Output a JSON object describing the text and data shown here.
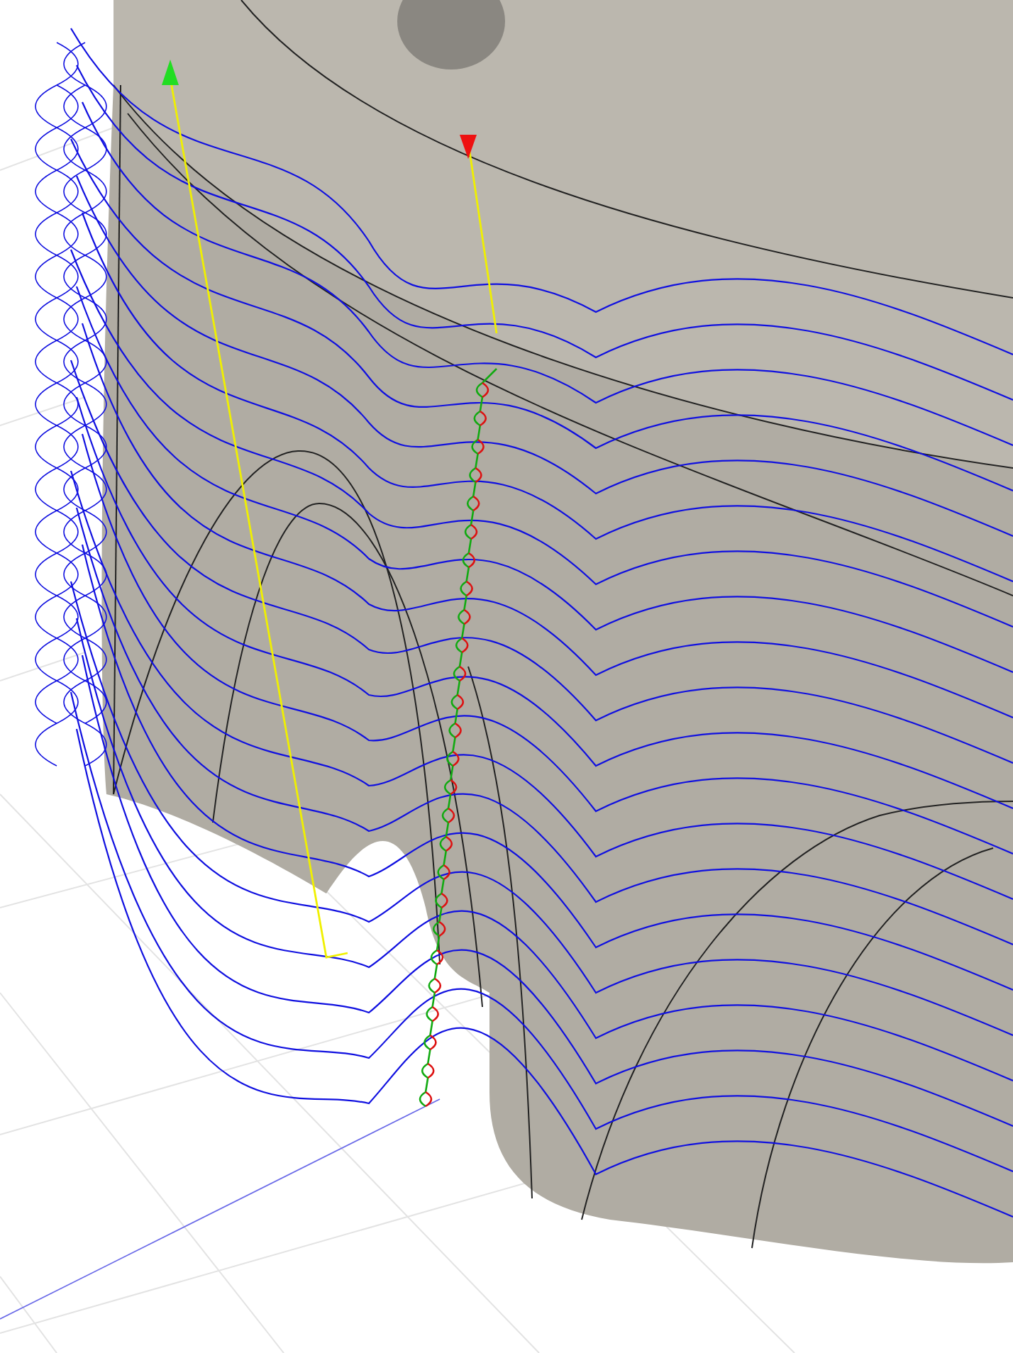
{
  "viewport": {
    "kind": "toolpath_view"
  }
}
